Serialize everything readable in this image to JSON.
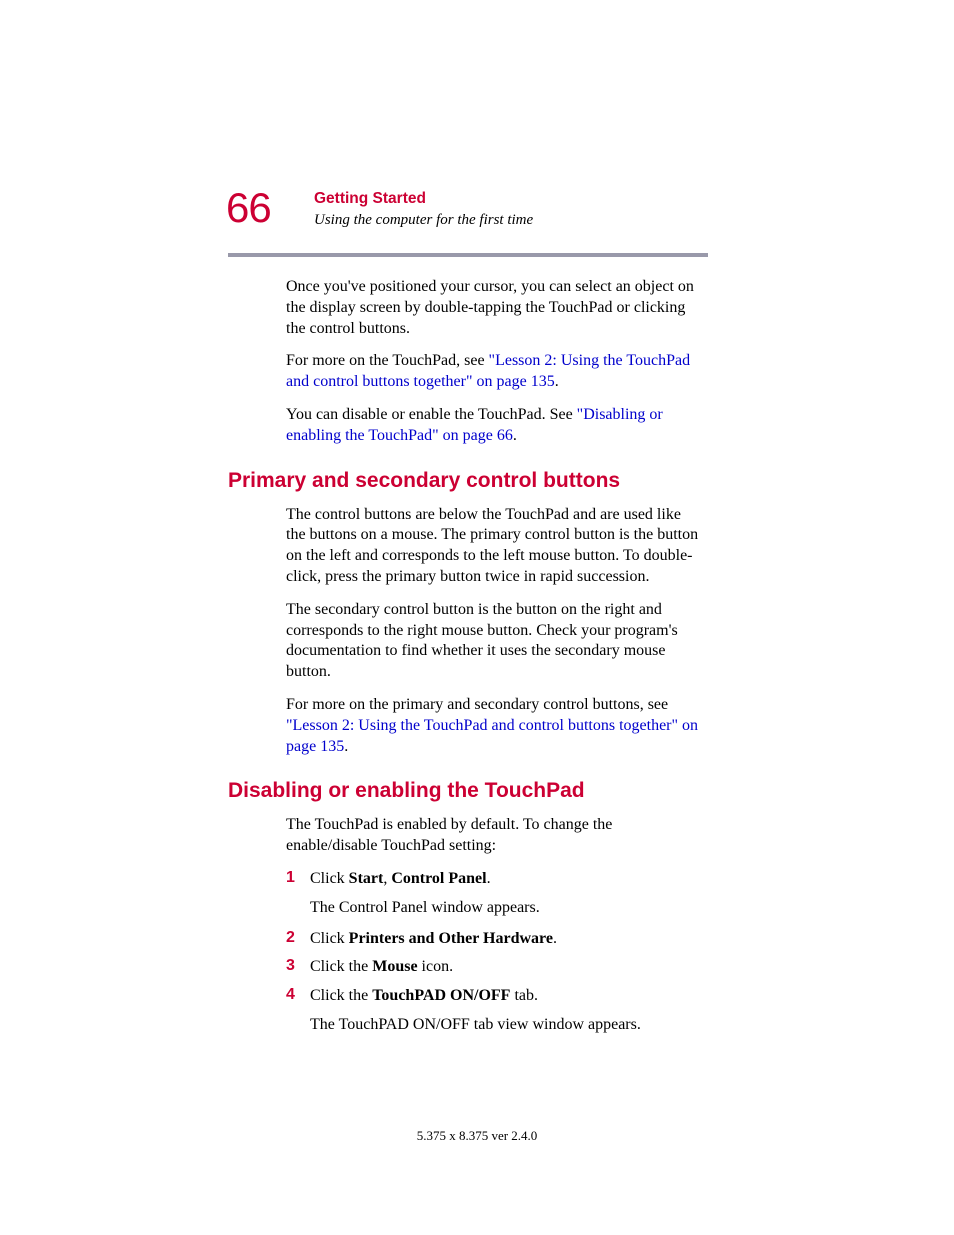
{
  "header": {
    "page_number": "66",
    "chapter": "Getting Started",
    "subtitle": "Using the computer for the first time"
  },
  "intro": {
    "p1": "Once you've positioned your cursor, you can select an object on the display screen by double-tapping the TouchPad or clicking the control buttons.",
    "p2_pre": "For more on the TouchPad, see ",
    "p2_link": "\"Lesson 2: Using the TouchPad and control buttons together\" on page 135",
    "p2_post": ".",
    "p3_pre": "You can disable or enable the TouchPad. See ",
    "p3_link": "\"Disabling or enabling the TouchPad\" on page 66",
    "p3_post": "."
  },
  "section1": {
    "heading": "Primary and secondary control buttons",
    "p1": "The control buttons are below the TouchPad and are used like the buttons on a mouse. The primary control button is the button on the left and corresponds to the left mouse button. To double-click, press the primary button twice in rapid succession.",
    "p2": "The secondary control button is the button on the right and corresponds to the right mouse button. Check your program's documentation to find whether it uses the secondary mouse button.",
    "p3_pre": "For more on the primary and secondary control buttons, see ",
    "p3_link": "\"Lesson 2: Using the TouchPad and control buttons together\" on page 135",
    "p3_post": "."
  },
  "section2": {
    "heading": "Disabling or enabling the TouchPad",
    "p1": "The TouchPad is enabled by default. To change the enable/disable TouchPad setting:",
    "steps": {
      "n1": "1",
      "s1_a": "Click ",
      "s1_b": "Start",
      "s1_c": ", ",
      "s1_d": "Control Panel",
      "s1_e": ".",
      "s1_sub": "The Control Panel window appears.",
      "n2": "2",
      "s2_a": "Click ",
      "s2_b": "Printers and Other Hardware",
      "s2_c": ".",
      "n3": "3",
      "s3_a": "Click the ",
      "s3_b": "Mouse",
      "s3_c": " icon.",
      "n4": "4",
      "s4_a": "Click the ",
      "s4_b": "TouchPAD ON/OFF",
      "s4_c": " tab.",
      "s4_sub": "The TouchPAD ON/OFF tab view window appears."
    }
  },
  "footer": "5.375 x 8.375 ver 2.4.0"
}
